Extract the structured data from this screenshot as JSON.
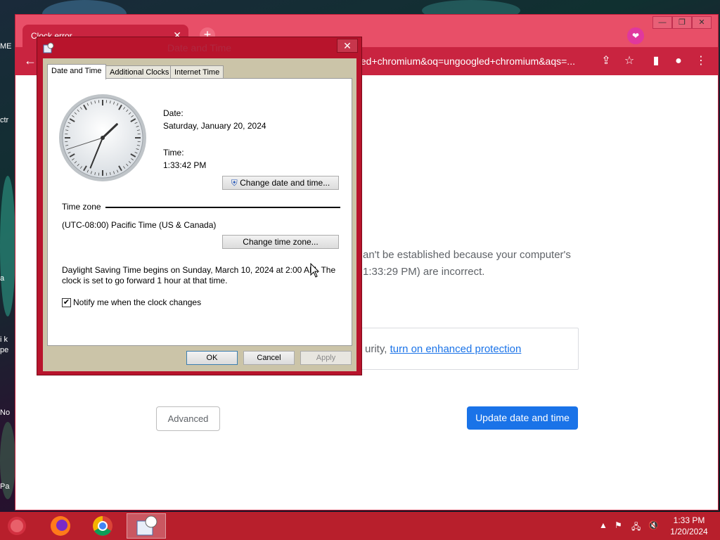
{
  "desktop": {
    "icon_labels": [
      "ME",
      "ctr",
      "a",
      "i k",
      "pe",
      "No",
      "Pa"
    ]
  },
  "browser": {
    "tab_title": "Clock error",
    "tab_close": "✕",
    "new_tab": "+",
    "address": "gled+chromium&oq=ungoogled+chromium&aqs=...",
    "window_controls": [
      "—",
      "❐",
      "✕"
    ],
    "error_line1": "an't be established because your computer's",
    "error_line2": "1:33:29 PM) are incorrect.",
    "info_prefix": "urity, ",
    "info_link": "turn on enhanced protection",
    "advanced_button": "Advanced",
    "update_button": "Update date and time",
    "accent_color": "#1a73e8",
    "frame_color": "#c92440"
  },
  "dialog": {
    "title": "Date and Time",
    "close": "✕",
    "tabs": [
      "Date and Time",
      "Additional Clocks",
      "Internet Time"
    ],
    "date_label": "Date:",
    "date_value": "Saturday, January 20, 2024",
    "time_label": "Time:",
    "time_value": "1:33:42 PM",
    "change_datetime_button": "Change date and time...",
    "time_zone_header": "Time zone",
    "time_zone_value": "(UTC-08:00) Pacific Time (US & Canada)",
    "change_timezone_button": "Change time zone...",
    "dst_line1": "Daylight Saving Time begins on Sunday, March 10, 2024 at 2:00 AM. The",
    "dst_line2": "clock is set to go forward 1 hour at that time.",
    "notify_label": "Notify me when the clock changes",
    "notify_checked": true,
    "ok": "OK",
    "cancel": "Cancel",
    "apply": "Apply",
    "clock_hours": 1,
    "clock_minutes": 33,
    "clock_seconds": 42
  },
  "taskbar": {
    "apps": [
      "start-orb",
      "firefox",
      "chrome",
      "date-time-settings"
    ],
    "clock_time": "1:33 PM",
    "clock_date": "1/20/2024",
    "color": "#b81f2c"
  }
}
